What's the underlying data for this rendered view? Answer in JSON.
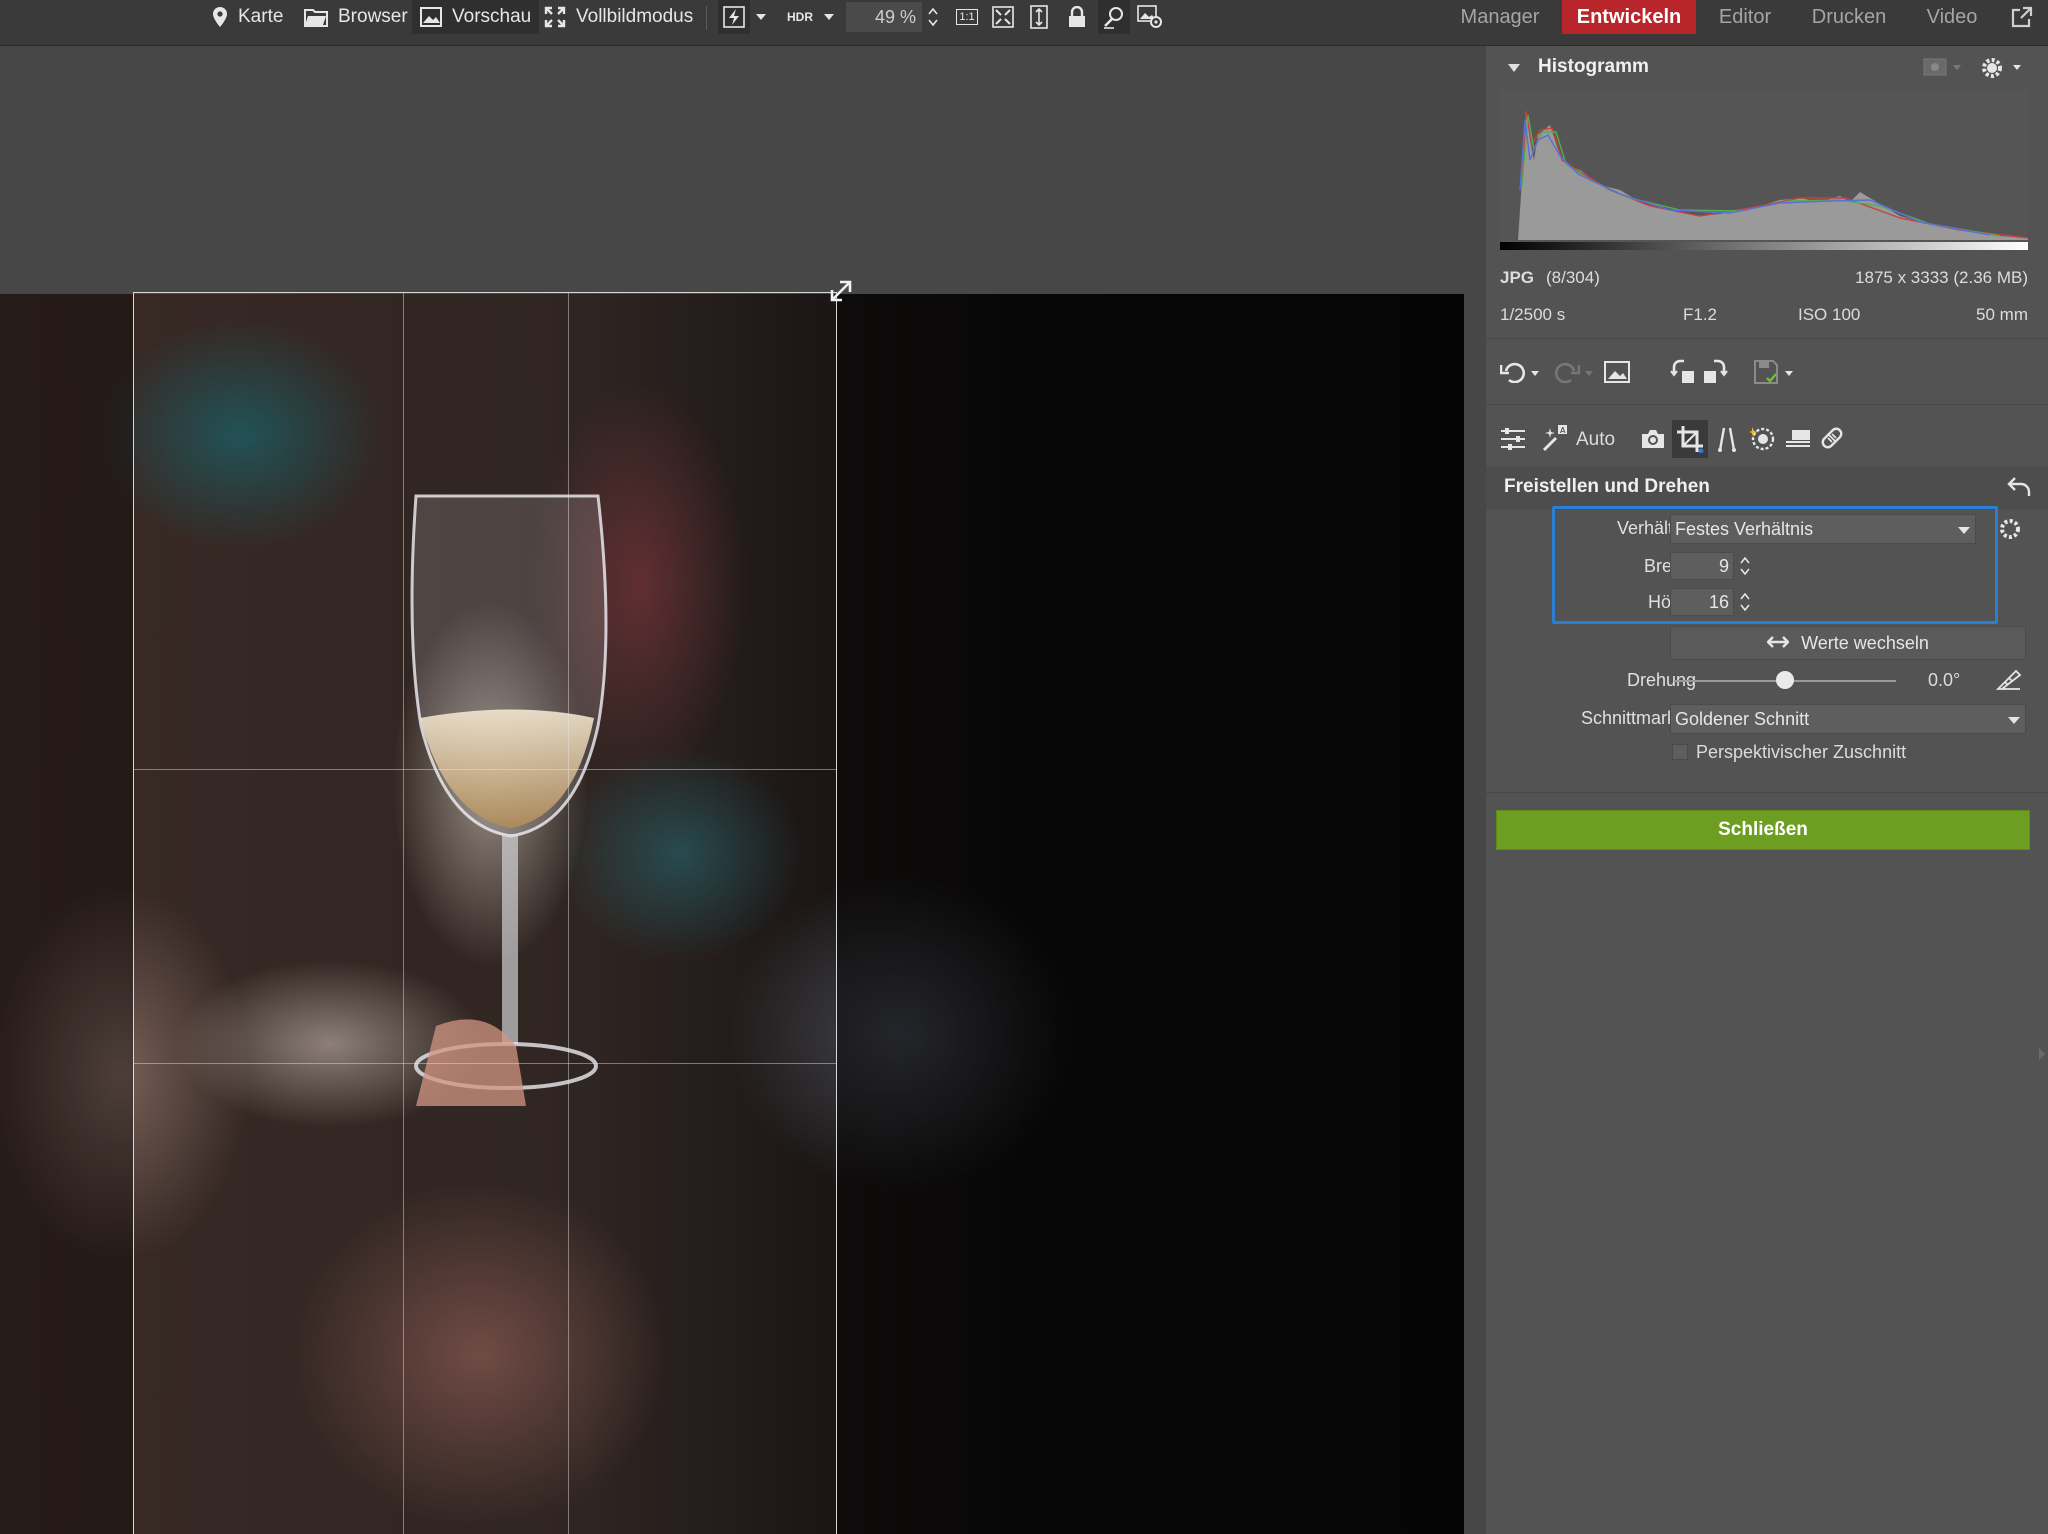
{
  "toolbar": {
    "map": "Karte",
    "browser": "Browser",
    "preview": "Vorschau",
    "fullscreen": "Vollbildmodus",
    "hdr": "HDR",
    "zoom": "49 %",
    "one_to_one": "1:1"
  },
  "modules": {
    "manager": "Manager",
    "develop": "Entwickeln",
    "editor": "Editor",
    "print": "Drucken",
    "video": "Video"
  },
  "histogram": {
    "title": "Histogramm"
  },
  "file_info": {
    "format": "JPG",
    "index": "(8/304)",
    "dimensions": "1875 x 3333 (2.36 MB)",
    "shutter": "1/2500 s",
    "aperture": "F1.2",
    "iso": "ISO 100",
    "focal": "50 mm"
  },
  "tools": {
    "auto": "Auto"
  },
  "crop": {
    "title": "Freistellen und Drehen",
    "ratio_label": "Verhältnis",
    "ratio_value": "Festes Verhältnis",
    "width_label": "Breite:",
    "width_value": "9",
    "height_label": "Höhe:",
    "height_value": "16",
    "swap": "Werte wechseln",
    "rotation_label": "Drehung",
    "rotation_value": "0.0°",
    "rotation_level": 0.5,
    "guides_label": "Schnittmarken",
    "guides_value": "Goldener Schnitt",
    "perspective": "Perspektivischer Zuschnitt",
    "perspective_checked": false,
    "close": "Schließen"
  },
  "rating": {
    "stars": "★★★★★"
  },
  "colors": {
    "active_module": "#b8252a",
    "close_button": "#6d9e22",
    "highlight": "#2a7fd4"
  }
}
